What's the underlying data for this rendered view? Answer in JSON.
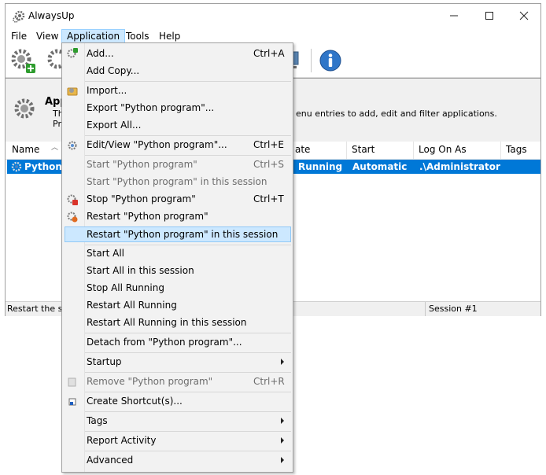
{
  "window": {
    "title": "AlwaysUp"
  },
  "menubar": {
    "items": [
      "File",
      "View",
      "Application",
      "Tools",
      "Help"
    ]
  },
  "infopanel": {
    "title": "App",
    "line1": "The",
    "line2": "Pre",
    "tail": "enu entries to add, edit and filter applications."
  },
  "list": {
    "headers": {
      "name": "Name",
      "state": "ate",
      "start": "Start",
      "logon": "Log On As",
      "tags": "Tags"
    },
    "rows": [
      {
        "name": "Python p",
        "state": "Running",
        "start": "Automatic",
        "logon": ".\\Administrator"
      }
    ]
  },
  "statusbar": {
    "left": "Restart the se",
    "session": "Session #1"
  },
  "dropdown": {
    "items": [
      {
        "label": "Add...",
        "shortcut": "Ctrl+A"
      },
      {
        "label": "Add Copy..."
      },
      {
        "label": "Import..."
      },
      {
        "label": "Export \"Python program\"..."
      },
      {
        "label": "Export All..."
      },
      {
        "label": "Edit/View \"Python program\"...",
        "shortcut": "Ctrl+E"
      },
      {
        "label": "Start \"Python program\"",
        "shortcut": "Ctrl+S",
        "disabled": true
      },
      {
        "label": "Start \"Python program\" in this session",
        "disabled": true
      },
      {
        "label": "Stop \"Python program\"",
        "shortcut": "Ctrl+T"
      },
      {
        "label": "Restart \"Python program\""
      },
      {
        "label": "Restart \"Python program\" in this session",
        "highlighted": true
      },
      {
        "label": "Start All"
      },
      {
        "label": "Start All in this session"
      },
      {
        "label": "Stop All Running"
      },
      {
        "label": "Restart All Running"
      },
      {
        "label": "Restart All Running in this session"
      },
      {
        "label": "Detach from \"Python program\"..."
      },
      {
        "label": "Startup",
        "submenu": true
      },
      {
        "label": "Remove \"Python program\"",
        "shortcut": "Ctrl+R",
        "disabled": true
      },
      {
        "label": "Create Shortcut(s)..."
      },
      {
        "label": "Tags",
        "submenu": true
      },
      {
        "label": "Report Activity",
        "submenu": true
      },
      {
        "label": "Advanced",
        "submenu": true
      }
    ]
  },
  "colors": {
    "accent": "#0078d7",
    "highlight": "#cce8ff",
    "disabled": "#6d6d6d"
  },
  "icons": [
    "gear-icon",
    "info-icon",
    "import-icon",
    "shortcut-icon"
  ]
}
